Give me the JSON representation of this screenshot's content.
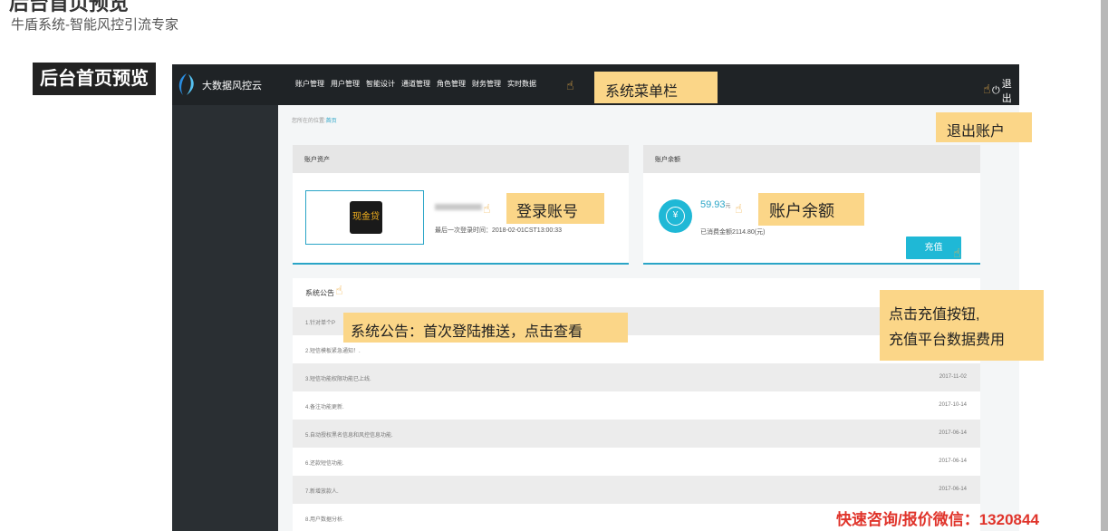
{
  "page": {
    "title": "后台首页预览",
    "subtitle": "牛盾系统-智能风控引流专家",
    "section_label": "后台首页预览"
  },
  "app": {
    "brand": "大数据风控云",
    "nav": [
      "账户管理",
      "用户管理",
      "智能设计",
      "通道管理",
      "角色管理",
      "财务管理",
      "实时数据"
    ],
    "logout": "退出",
    "breadcrumb_prefix": "您所在的位置:",
    "breadcrumb_current": "首页"
  },
  "assets_panel": {
    "title": "账户资产",
    "logo_text": "现金贷",
    "last_login": "最后一次登录时间：2018-02-01CST13:00:33"
  },
  "balance_panel": {
    "title": "账户余额",
    "amount": "59.93",
    "unit": "元",
    "spent": "已消费金额2114.80(元)",
    "recharge_label": "充值"
  },
  "notice_panel": {
    "title": "系统公告",
    "rows": [
      {
        "text": "1.针对单个P",
        "date": ""
      },
      {
        "text": "2.短信模板紧急通知！.",
        "date": ""
      },
      {
        "text": "3.短信功能权限功能已上线.",
        "date": "2017-11-02"
      },
      {
        "text": "4.备注功能更新.",
        "date": "2017-10-14"
      },
      {
        "text": "5.自动授权黑名信息和风控信息功能.",
        "date": "2017-06-14"
      },
      {
        "text": "6.还款短信功能.",
        "date": "2017-06-14"
      },
      {
        "text": "7.新增放款人.",
        "date": "2017-06-14"
      },
      {
        "text": "8.用户数据分析.",
        "date": ""
      }
    ]
  },
  "callouts": {
    "menu": "系统菜单栏",
    "logout": "退出账户",
    "account": "登录账号",
    "balance": "账户余额",
    "notice": "系统公告：首次登陆推送，点击查看",
    "recharge_line1": "点击充值按钮,",
    "recharge_line2": "充值平台数据费用"
  },
  "footer": {
    "contact": "快速咨询/报价微信：1320844"
  },
  "colors": {
    "accent": "#2aa5c7",
    "callout": "#fbd688",
    "topbar": "#1f2326",
    "ad": "#e0342b"
  }
}
